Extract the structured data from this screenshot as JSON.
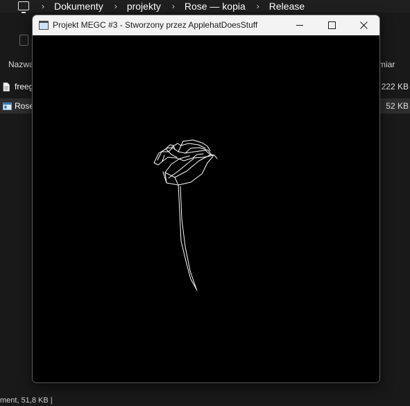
{
  "explorer": {
    "breadcrumb": [
      "Dokumenty",
      "projekty",
      "Rose — kopia",
      "Release"
    ],
    "columns": {
      "name": "Nazwa",
      "size": "miar"
    },
    "files": [
      {
        "name": "freeg",
        "size": "222 KB",
        "icon": "document-icon"
      },
      {
        "name": "Rose",
        "size": "52 KB",
        "icon": "application-icon"
      }
    ],
    "status": "ment, 51,8 KB  |"
  },
  "window": {
    "title": "Projekt MEGC #3 - Stworzony przez ApplehatDoesStuff",
    "controls": [
      "minimize",
      "maximize",
      "close"
    ],
    "canvas_background": "#000000",
    "drawing": "rose-line-art",
    "stroke_color": "#ffffff"
  }
}
